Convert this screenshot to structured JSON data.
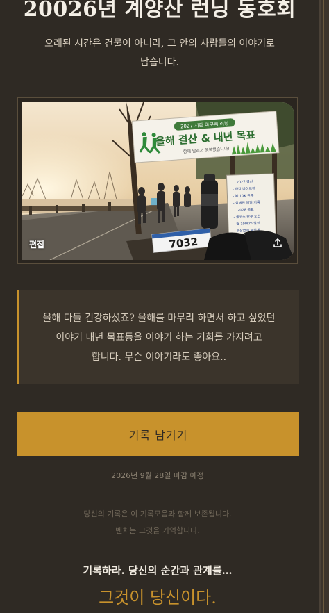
{
  "header": {
    "title": "20026년 계양산 런닝 동호회",
    "intro_line1": "오래된 시간은 건물이 아니라, 그 안의 사람들의 이야기로",
    "intro_line2": "남습니다."
  },
  "photo": {
    "edit_label": "편집",
    "share_icon": "share-upload-icon",
    "banner_small": "2027 시즌 마무리 러닝",
    "banner_main": "올해 결산 & 내년 목표",
    "banner_sub": "함께 달려서 행복했습니다!",
    "bib_number": "7032",
    "board_lines": [
      "2027 결산",
      "- 한강 나이트런",
      "- 봄 10K 완주",
      "- 함께한 매일 기록",
      "2028 목표",
      "- 풀코스 완주 도전",
      "- 월 100km 달성",
      "- 부상없이 즐겁게"
    ]
  },
  "message": {
    "line1": "올해 다들 건강하셨죠? 올해를 마무리 하면서 하고 싶었던",
    "line2": "이야기 내년 목표등을 이야기 하는 기회를 가지려고",
    "line3": "합니다. 무슨 이야기라도 좋아요.."
  },
  "cta": {
    "label": "기록 남기기"
  },
  "deadline": "2026년 9월 28일 마감 예정",
  "note": {
    "line1": "당신의 기록은 이 기록모음과 함께 보존됩니다.",
    "line2": "벤치는 그것을 기억합니다."
  },
  "footer": {
    "tagline": "기록하라. 당신의 순간과 관계를…",
    "accent": "그것이 당신이다."
  },
  "colors": {
    "background": "#2f2a24",
    "accent": "#c8922c",
    "panel": "#3b342b"
  }
}
